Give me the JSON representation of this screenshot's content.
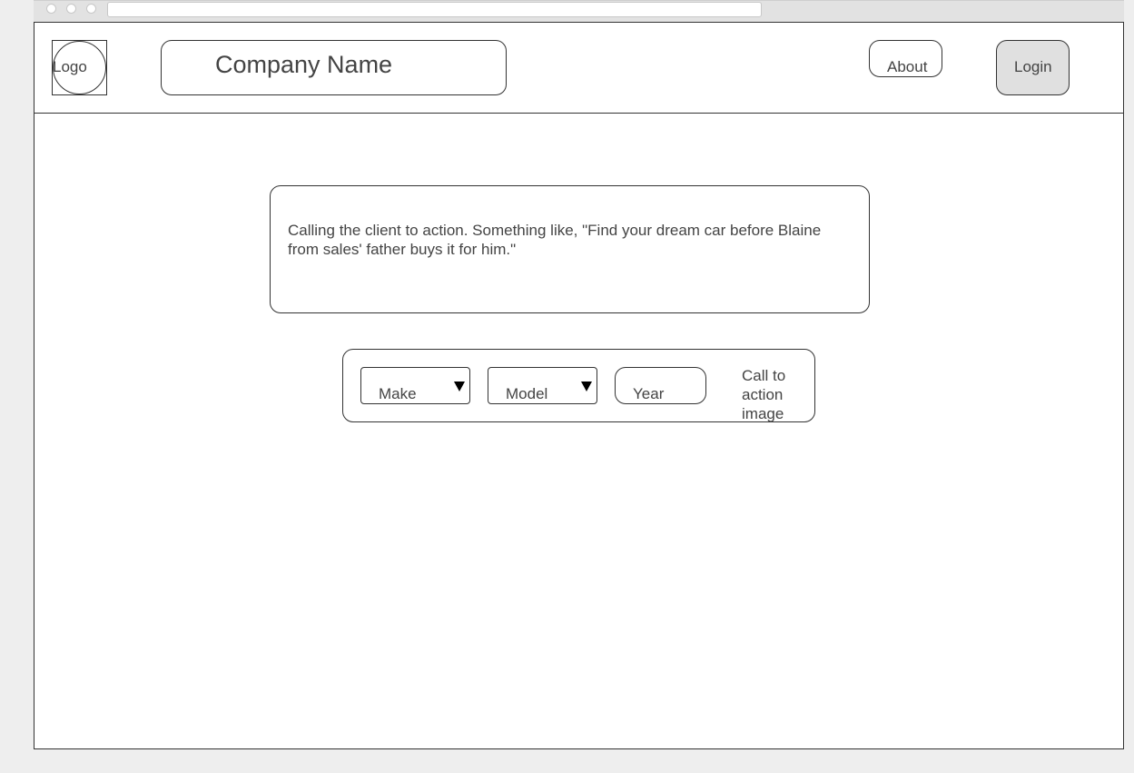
{
  "header": {
    "logo_label": "Logo",
    "company_name": "Company Name",
    "about_label": "About",
    "login_label": "Login"
  },
  "hero": {
    "cta_text": "Calling the client to action. Something like, \"Find your dream car before Blaine from sales' father buys it for him.\""
  },
  "search": {
    "make_label": "Make",
    "model_label": "Model",
    "year_label": "Year",
    "image_label": "Call to action image"
  },
  "icons": {
    "make_caret": "caret-down-icon",
    "model_caret": "caret-down-icon"
  }
}
